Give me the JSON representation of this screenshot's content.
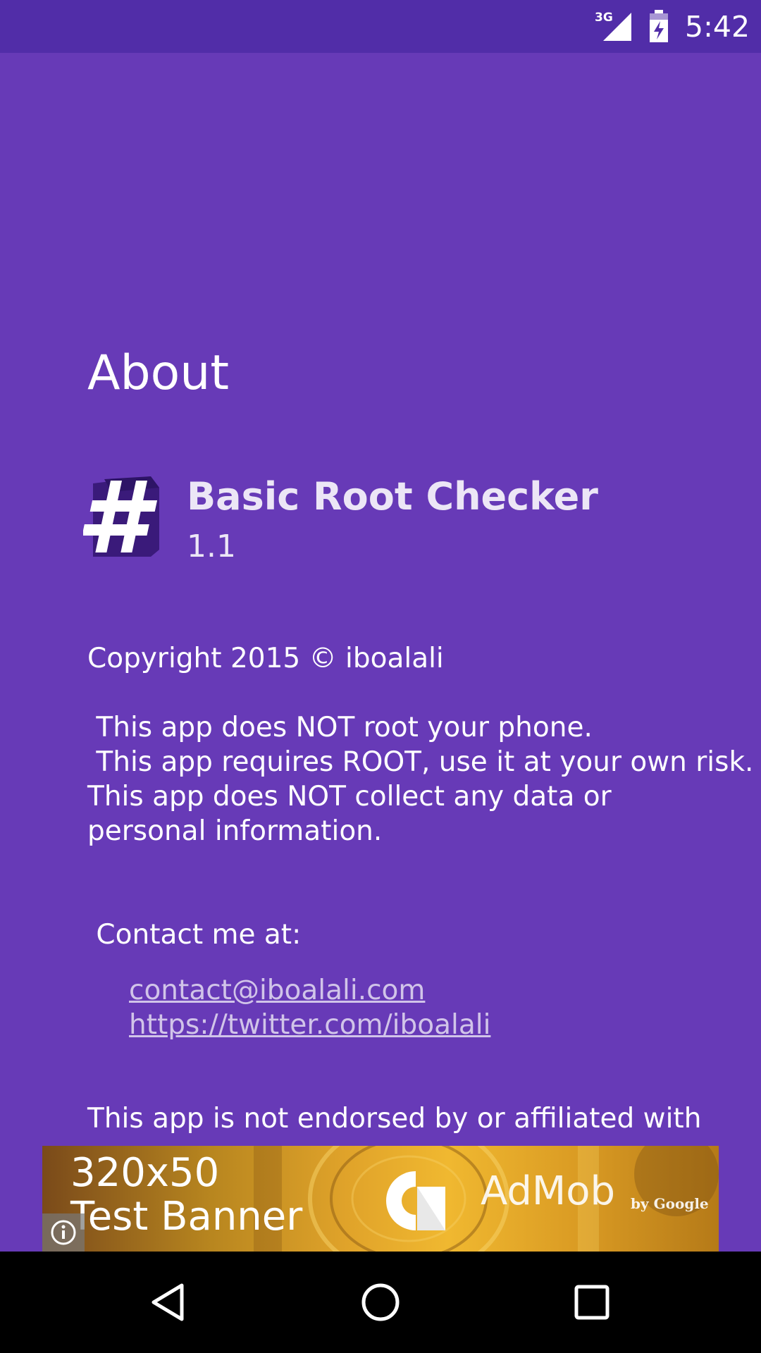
{
  "status_bar": {
    "network": "3G",
    "time": "5:42",
    "icons": [
      "signal-icon",
      "battery-charging-icon"
    ]
  },
  "page": {
    "title": "About"
  },
  "app": {
    "icon": "hash-app-icon",
    "name": "Basic Root Checker",
    "version": "1.1"
  },
  "copyright": "Copyright 2015 © iboalali",
  "disclaimer": [
    " This app does NOT root your phone.",
    " This app requires ROOT, use it at your own risk.",
    " This app does NOT collect any data or personal information."
  ],
  "contact": {
    "label": " Contact me at:",
    "email": "contact@iboalali.com",
    "twitter": "https://twitter.com/iboalali"
  },
  "not_endorsed": "This app is not endorsed by or affiliated with",
  "ad_banner": {
    "text": "320x50\nTest Banner",
    "brand": "AdMob",
    "brand_sub": "by Google",
    "icons": [
      "admob-logo-icon",
      "info-icon"
    ]
  },
  "nav_bar": {
    "icons": [
      "back-icon",
      "home-icon",
      "recents-icon"
    ]
  },
  "colors": {
    "background": "#673ab7",
    "status_bar": "#512da8",
    "link": "#d1c4e9"
  }
}
